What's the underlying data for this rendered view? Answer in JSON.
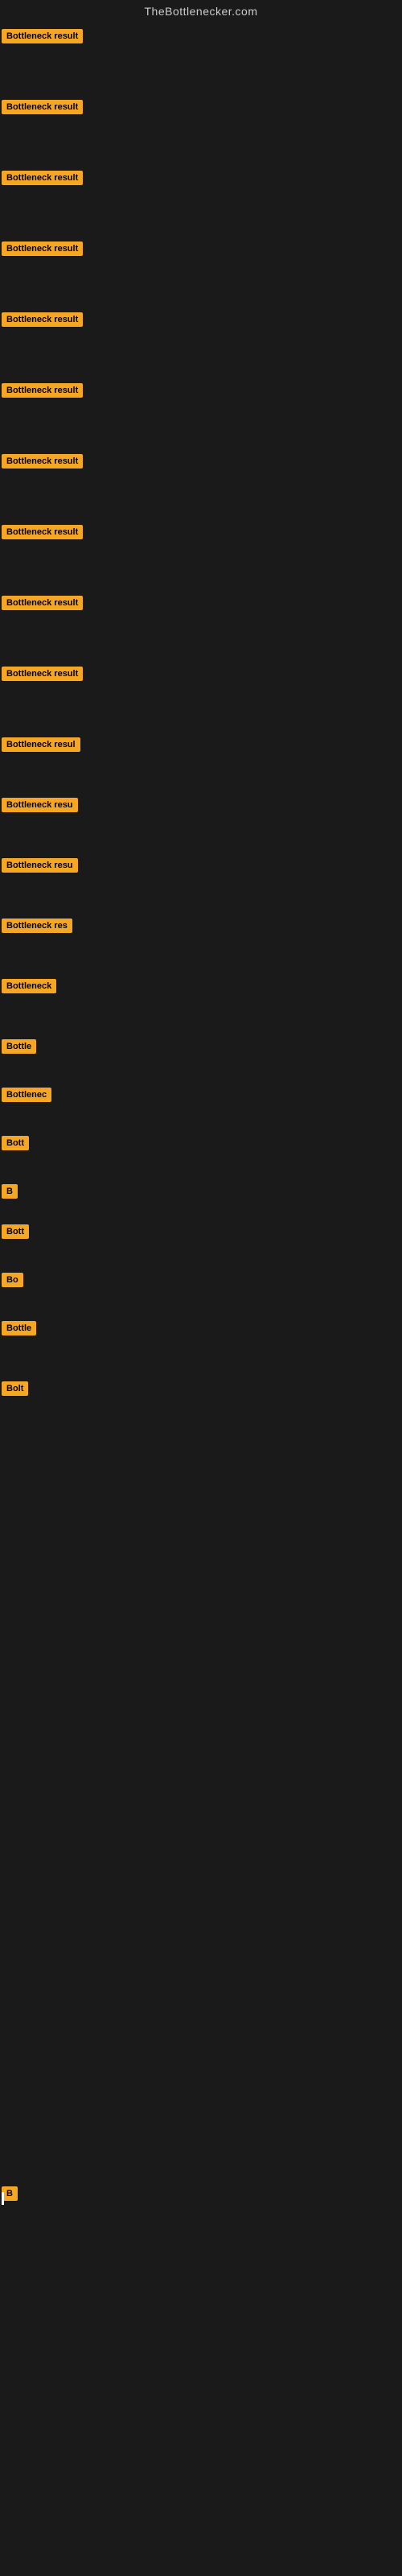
{
  "site": {
    "title": "TheBottlenecker.com"
  },
  "badge": {
    "label": "Bottleneck result",
    "color": "#f5a623"
  },
  "rows": [
    {
      "id": 1,
      "label": "Bottleneck result",
      "truncate": false,
      "height": "88"
    },
    {
      "id": 2,
      "label": "Bottleneck result",
      "truncate": false,
      "height": "88"
    },
    {
      "id": 3,
      "label": "Bottleneck result",
      "truncate": false,
      "height": "88"
    },
    {
      "id": 4,
      "label": "Bottleneck result",
      "truncate": false,
      "height": "88"
    },
    {
      "id": 5,
      "label": "Bottleneck result",
      "truncate": false,
      "height": "88"
    },
    {
      "id": 6,
      "label": "Bottleneck result",
      "truncate": false,
      "height": "88"
    },
    {
      "id": 7,
      "label": "Bottleneck result",
      "truncate": false,
      "height": "88"
    },
    {
      "id": 8,
      "label": "Bottleneck result",
      "truncate": false,
      "height": "88"
    },
    {
      "id": 9,
      "label": "Bottleneck result",
      "truncate": false,
      "height": "88"
    },
    {
      "id": 10,
      "label": "Bottleneck result",
      "truncate": false,
      "height": "88"
    },
    {
      "id": 11,
      "label": "Bottleneck resul",
      "truncate": true,
      "height": "75"
    },
    {
      "id": 12,
      "label": "Bottleneck resu",
      "truncate": true,
      "height": "75"
    },
    {
      "id": 13,
      "label": "Bottleneck resu",
      "truncate": true,
      "height": "75"
    },
    {
      "id": 14,
      "label": "Bottleneck res",
      "truncate": true,
      "height": "75"
    },
    {
      "id": 15,
      "label": "Bottleneck",
      "truncate": true,
      "height": "75"
    },
    {
      "id": 16,
      "label": "Bottle",
      "truncate": true,
      "height": "60"
    },
    {
      "id": 17,
      "label": "Bottlenec",
      "truncate": true,
      "height": "60"
    },
    {
      "id": 18,
      "label": "Bott",
      "truncate": true,
      "height": "60"
    },
    {
      "id": 19,
      "label": "B",
      "truncate": true,
      "height": "50"
    },
    {
      "id": 20,
      "label": "Bott",
      "truncate": true,
      "height": "60"
    },
    {
      "id": 21,
      "label": "Bo",
      "truncate": true,
      "height": "60"
    },
    {
      "id": 22,
      "label": "Bottle",
      "truncate": true,
      "height": "75"
    },
    {
      "id": 23,
      "label": "Bolt",
      "truncate": true,
      "height": "110"
    },
    {
      "id": 24,
      "label": "",
      "truncate": true,
      "height": "160"
    },
    {
      "id": 25,
      "label": "",
      "truncate": true,
      "height": "160"
    },
    {
      "id": 26,
      "label": "",
      "truncate": true,
      "height": "160"
    },
    {
      "id": 27,
      "label": "",
      "truncate": true,
      "height": "160"
    },
    {
      "id": 28,
      "label": "",
      "truncate": true,
      "height": "250"
    },
    {
      "id": 29,
      "label": "B",
      "truncate": true,
      "height": "50",
      "cursor": true
    }
  ]
}
